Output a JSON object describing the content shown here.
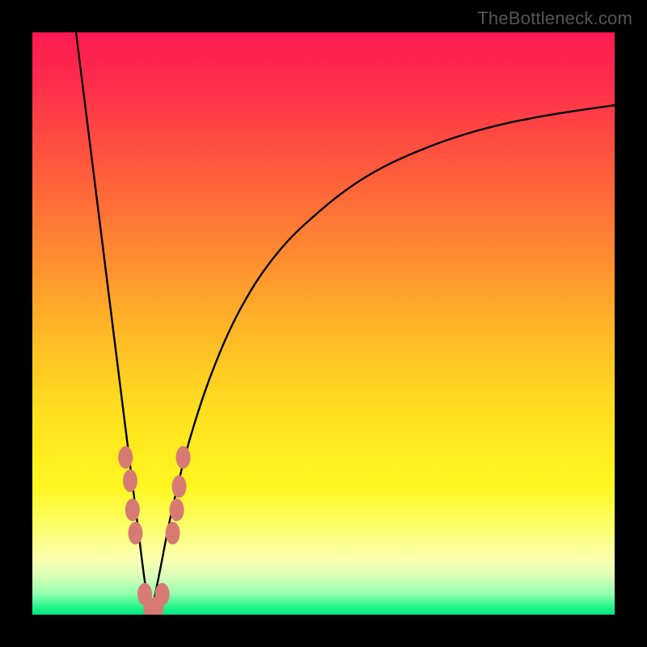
{
  "watermark": "TheBottleneck.com",
  "chart_data": {
    "type": "line",
    "title": "",
    "xlabel": "",
    "ylabel": "",
    "xlim": [
      0,
      100
    ],
    "ylim": [
      0,
      100
    ],
    "grid": false,
    "legend": false,
    "gradient_stops": [
      {
        "offset": 0.0,
        "color": "#ff1a52"
      },
      {
        "offset": 0.08,
        "color": "#ff2b4d"
      },
      {
        "offset": 0.2,
        "color": "#ff503f"
      },
      {
        "offset": 0.35,
        "color": "#ff8033"
      },
      {
        "offset": 0.5,
        "color": "#ffb327"
      },
      {
        "offset": 0.65,
        "color": "#ffdf1f"
      },
      {
        "offset": 0.78,
        "color": "#fff71f"
      },
      {
        "offset": 0.85,
        "color": "#fdff6b"
      },
      {
        "offset": 0.905,
        "color": "#fbffb0"
      },
      {
        "offset": 0.935,
        "color": "#d8ffb8"
      },
      {
        "offset": 0.965,
        "color": "#8fffad"
      },
      {
        "offset": 0.985,
        "color": "#2cf58e"
      },
      {
        "offset": 1.0,
        "color": "#00e77e"
      }
    ],
    "series": [
      {
        "name": "bottleneck-curve-left",
        "x": [
          7.5,
          9,
          10.5,
          12,
          13.5,
          15,
          16.5,
          18,
          19,
          19.7,
          20.3
        ],
        "y": [
          100,
          88,
          76,
          64,
          52,
          40,
          28,
          16,
          8,
          3,
          0
        ]
      },
      {
        "name": "bottleneck-curve-right",
        "x": [
          20.3,
          21,
          22,
          24,
          27,
          31,
          36,
          42,
          49,
          57,
          66,
          76,
          87,
          100
        ],
        "y": [
          0,
          3,
          8,
          18,
          30,
          42,
          53,
          62,
          69,
          75,
          79.5,
          83,
          85.5,
          87.5
        ]
      }
    ],
    "markers": {
      "name": "highlighted-points",
      "color": "#d77a74",
      "points": [
        {
          "x": 16.0,
          "y": 27
        },
        {
          "x": 16.8,
          "y": 23
        },
        {
          "x": 17.2,
          "y": 18
        },
        {
          "x": 17.7,
          "y": 14
        },
        {
          "x": 19.3,
          "y": 3.5
        },
        {
          "x": 20.3,
          "y": 1.0
        },
        {
          "x": 21.3,
          "y": 1.2
        },
        {
          "x": 22.3,
          "y": 3.5
        },
        {
          "x": 24.1,
          "y": 14
        },
        {
          "x": 24.8,
          "y": 18
        },
        {
          "x": 25.2,
          "y": 22
        },
        {
          "x": 25.9,
          "y": 27
        }
      ]
    }
  }
}
